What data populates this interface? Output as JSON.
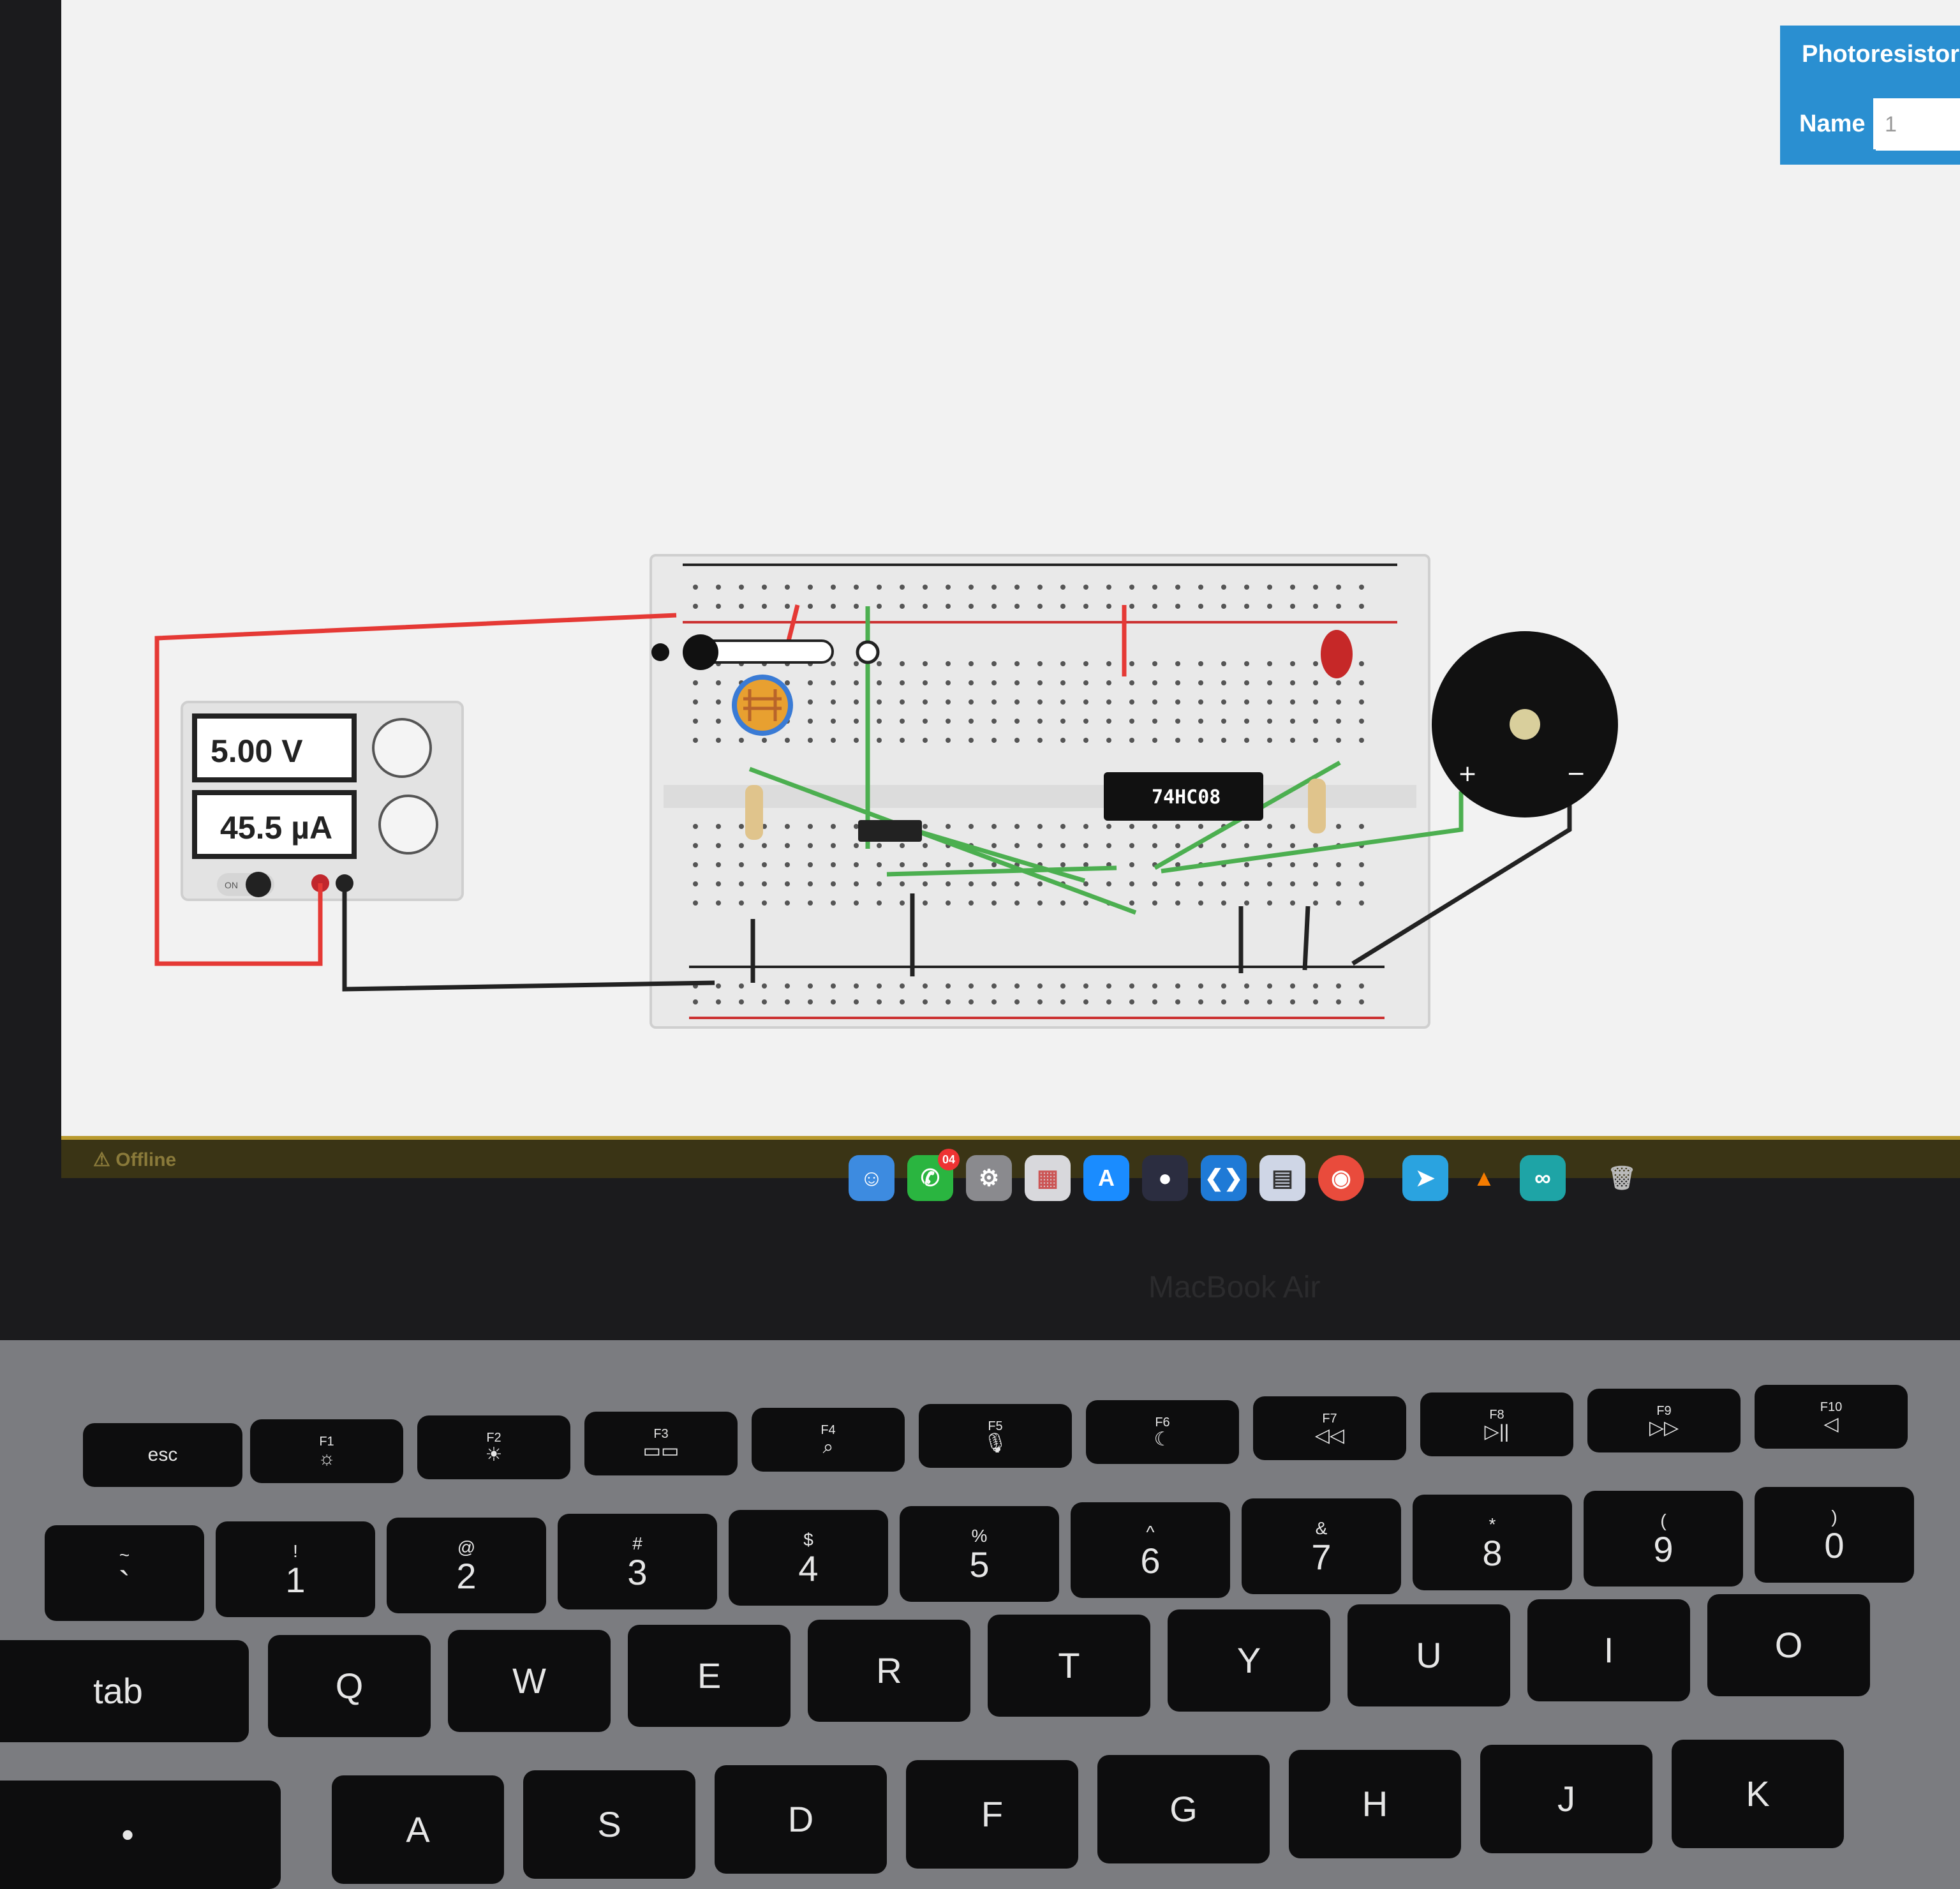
{
  "inspector": {
    "title": "Photoresistor",
    "name_label": "Name",
    "name_value": "1"
  },
  "power_supply": {
    "voltage": "5.00 V",
    "current": "45.5 µA",
    "switch": "ON"
  },
  "chip_label": "74HC08",
  "status": {
    "offline": "Offline"
  },
  "dock": {
    "apps": [
      "finder",
      "whatsapp",
      "system-preferences",
      "launchpad",
      "app-store",
      "davinci-resolve",
      "vs-code",
      "preview",
      "chrome",
      "telegram",
      "vlc",
      "arduino",
      "trash"
    ],
    "whatsapp_badge": "04"
  },
  "brand": "MacBook Air",
  "keyboard": {
    "fn_row": [
      {
        "t": "esc",
        "s": ""
      },
      {
        "t": "☼",
        "s": "F1"
      },
      {
        "t": "☀",
        "s": "F2"
      },
      {
        "t": "▭▭",
        "s": "F3"
      },
      {
        "t": "⌕",
        "s": "F4"
      },
      {
        "t": "🎙",
        "s": "F5"
      },
      {
        "t": "☾",
        "s": "F6"
      },
      {
        "t": "◁◁",
        "s": "F7"
      },
      {
        "t": "▷||",
        "s": "F8"
      },
      {
        "t": "▷▷",
        "s": "F9"
      },
      {
        "t": "◁",
        "s": "F10"
      }
    ],
    "num_row": [
      {
        "s": "~",
        "t": "`"
      },
      {
        "s": "!",
        "t": "1"
      },
      {
        "s": "@",
        "t": "2"
      },
      {
        "s": "#",
        "t": "3"
      },
      {
        "s": "$",
        "t": "4"
      },
      {
        "s": "%",
        "t": "5"
      },
      {
        "s": "^",
        "t": "6"
      },
      {
        "s": "&",
        "t": "7"
      },
      {
        "s": "*",
        "t": "8"
      },
      {
        "s": "(",
        "t": "9"
      },
      {
        "s": ")",
        "t": "0"
      }
    ],
    "q_row": [
      "tab",
      "Q",
      "W",
      "E",
      "R",
      "T",
      "Y",
      "U",
      "I",
      "O"
    ],
    "a_row": [
      "•",
      "A",
      "S",
      "D",
      "F",
      "G",
      "H",
      "J",
      "K"
    ]
  }
}
